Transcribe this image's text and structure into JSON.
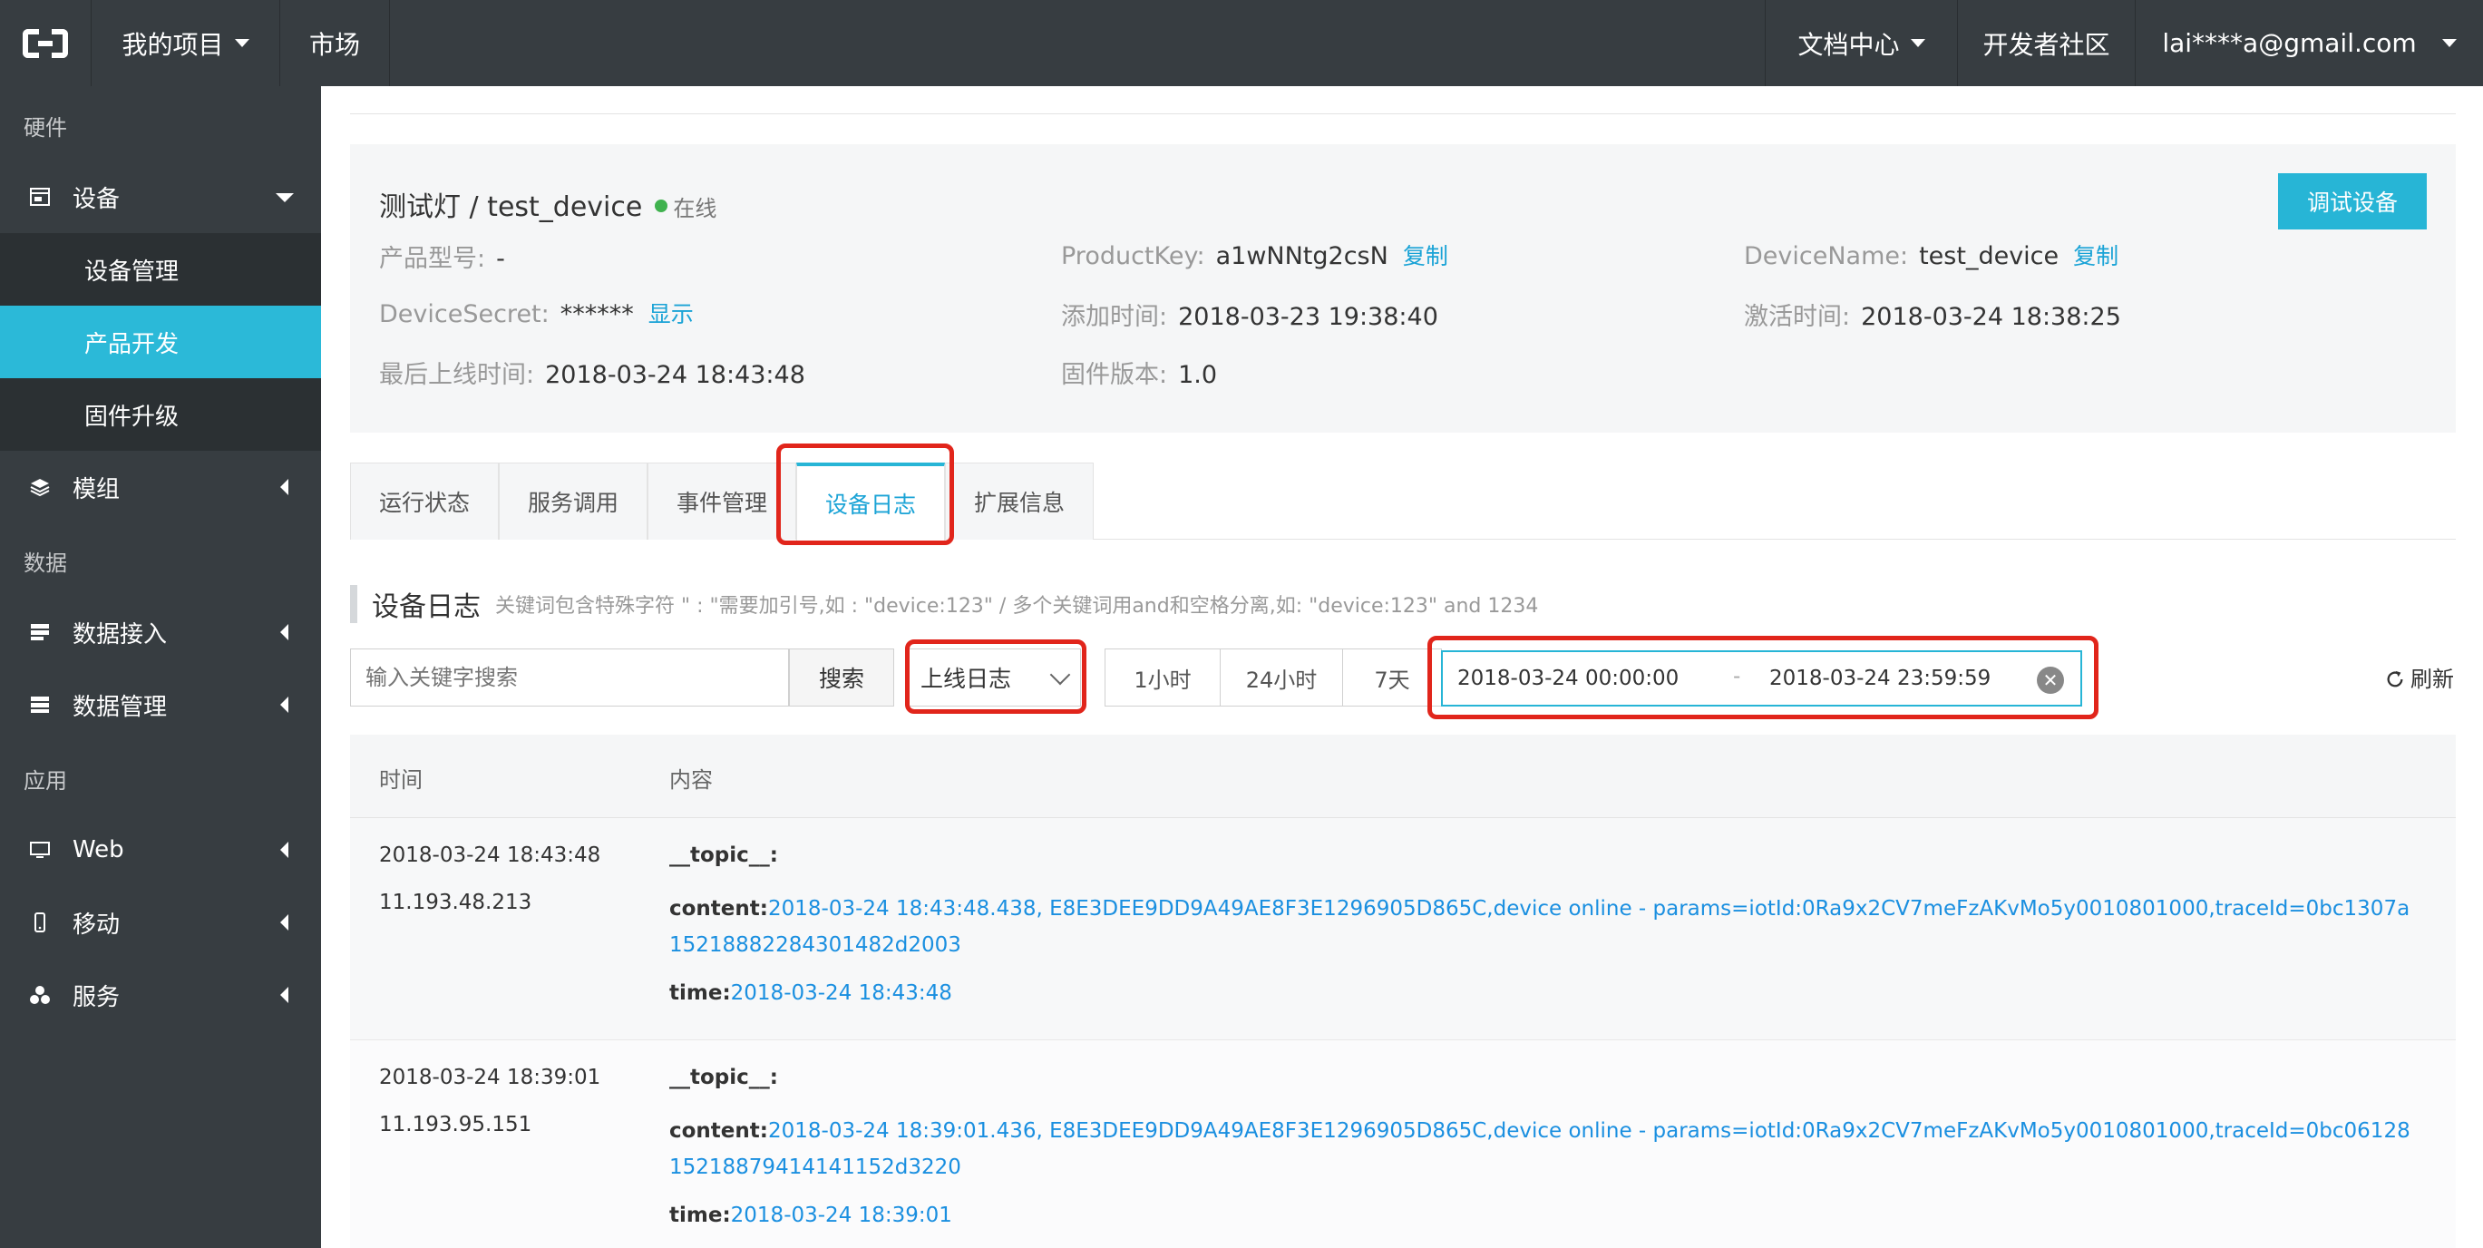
{
  "topbar": {
    "project_menu": "我的项目",
    "market": "市场",
    "docs": "文档中心",
    "community": "开发者社区",
    "account": "lai****a@gmail.com"
  },
  "sidebar": {
    "section_hardware": "硬件",
    "device": "设备",
    "device_mgmt": "设备管理",
    "product_dev": "产品开发",
    "firmware_upgrade": "固件升级",
    "module": "模组",
    "section_data": "数据",
    "data_access": "数据接入",
    "data_mgmt": "数据管理",
    "section_app": "应用",
    "web": "Web",
    "mobile": "移动",
    "service": "服务"
  },
  "device": {
    "title": "测试灯 / test_device",
    "status": "在线",
    "debug_button": "调试设备",
    "model_label": "产品型号:",
    "model_value": "-",
    "productkey_label": "ProductKey:",
    "productkey_value": "a1wNNtg2csN",
    "copy1": "复制",
    "devicename_label": "DeviceName:",
    "devicename_value": "test_device",
    "copy2": "复制",
    "secret_label": "DeviceSecret:",
    "secret_value": "******",
    "show": "显示",
    "added_label": "添加时间:",
    "added_value": "2018-03-23 19:38:40",
    "activated_label": "激活时间:",
    "activated_value": "2018-03-24 18:38:25",
    "lastonline_label": "最后上线时间:",
    "lastonline_value": "2018-03-24 18:43:48",
    "firmware_label": "固件版本:",
    "firmware_value": "1.0"
  },
  "tabs": [
    "运行状态",
    "服务调用",
    "事件管理",
    "设备日志",
    "扩展信息"
  ],
  "log": {
    "title": "设备日志",
    "hint": "关键词包含特殊字符 \" : \"需要加引号,如 : \"device:123\" / 多个关键词用and和空格分离,如: \"device:123\" and 1234",
    "search_placeholder": "输入关键字搜索",
    "search_button": "搜索",
    "type_select": "上线日志",
    "range_1h": "1小时",
    "range_24h": "24小时",
    "range_7d": "7天",
    "date_start": "2018-03-24 00:00:00",
    "date_sep": "-",
    "date_end": "2018-03-24 23:59:59",
    "refresh": "刷新",
    "col_time": "时间",
    "col_content": "内容",
    "rows": [
      {
        "time": "2018-03-24 18:43:48",
        "ip": "11.193.48.213",
        "topic": "__topic__:",
        "content_label": "content:",
        "content": "2018-03-24 18:43:48.438, E8E3DEE9DD9A49AE8F3E1296905D865C,device online - params=iotId:0Ra9x2CV7meFzAKvMo5y0010801000,traceId=0bc1307a15218882284301482d2003",
        "time_label": "time:",
        "time_value": "2018-03-24 18:43:48"
      },
      {
        "time": "2018-03-24 18:39:01",
        "ip": "11.193.95.151",
        "topic": "__topic__:",
        "content_label": "content:",
        "content": "2018-03-24 18:39:01.436, E8E3DEE9DD9A49AE8F3E1296905D865C,device online - params=iotId:0Ra9x2CV7meFzAKvMo5y0010801000,traceId=0bc0612815218879414141152d3220",
        "time_label": "time:",
        "time_value": "2018-03-24 18:39:01"
      }
    ]
  },
  "colors": {
    "topbar_bg": "#373d41",
    "accent": "#27b5d6",
    "link": "#1aa3d6",
    "highlight_box": "#e1251b",
    "online": "#3fb24e"
  },
  "icons": [
    "logo-icon",
    "device-icon",
    "layers-icon",
    "data-access-icon",
    "data-mgmt-icon",
    "monitor-icon",
    "mobile-icon",
    "service-icon",
    "clear-icon",
    "refresh-icon"
  ]
}
